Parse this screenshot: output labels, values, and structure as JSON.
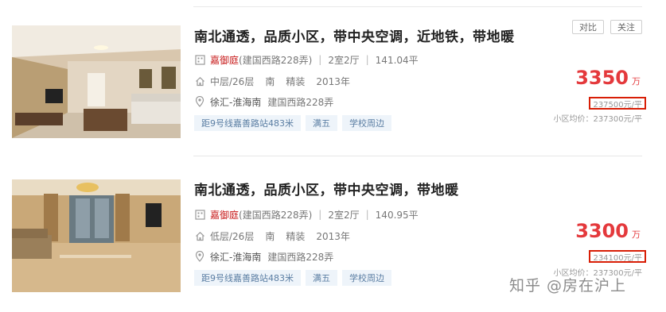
{
  "listings": [
    {
      "title": "南北通透，品质小区，带中央空调，近地铁，带地暖",
      "community": "嘉御庭",
      "address_paren": "(建国西路228弄)",
      "layout": "2室2厅",
      "area": "141.04平",
      "floor": "中层/26层",
      "orientation": "南",
      "decoration": "精装",
      "year": "2013年",
      "district": "徐汇-淮海南",
      "street": "建国西路228弄",
      "tags": [
        "距9号线嘉善路站483米",
        "满五",
        "学校周边"
      ],
      "compare_label": "对比",
      "follow_label": "关注",
      "price": "3350",
      "price_unit": "万",
      "unit_price": "237500元/平",
      "avg_price": "小区均价：237300元/平"
    },
    {
      "title": "南北通透，品质小区，带中央空调，带地暖",
      "community": "嘉御庭",
      "address_paren": "(建国西路228弄)",
      "layout": "2室2厅",
      "area": "140.95平",
      "floor": "低层/26层",
      "orientation": "南",
      "decoration": "精装",
      "year": "2013年",
      "district": "徐汇-淮海南",
      "street": "建国西路228弄",
      "tags": [
        "距9号线嘉善路站483米",
        "满五",
        "学校周边"
      ],
      "price": "3300",
      "price_unit": "万",
      "unit_price": "234100元/平",
      "avg_price": "小区均价：237300元/平"
    }
  ],
  "watermark": "知乎 @房在沪上",
  "colors": {
    "price": "#e4393c",
    "tag_bg": "#eef4fa",
    "tag_text": "#5b7ea3",
    "highlight_box": "#d81e06"
  }
}
